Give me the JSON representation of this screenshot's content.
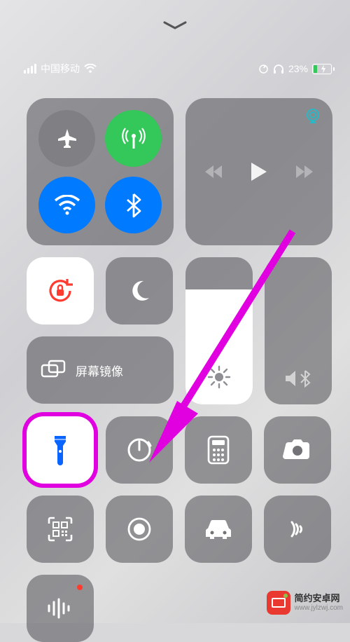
{
  "statusbar": {
    "carrier": "中国移动",
    "battery_percent": "23%",
    "battery_level_pct": 23
  },
  "media": {
    "airplay_color": "#2ab7c6"
  },
  "orientation_lock": {
    "tint": "#ff3b30"
  },
  "mirror": {
    "label": "屏幕镜像"
  },
  "brightness": {
    "level_pct": 78
  },
  "volume": {
    "level_pct": 0
  },
  "flashlight": {
    "on_color": "#0a64ff"
  },
  "highlight": {
    "color": "#e000e0"
  },
  "watermark": {
    "title": "简约安卓网",
    "url": "www.jylzwj.com"
  }
}
